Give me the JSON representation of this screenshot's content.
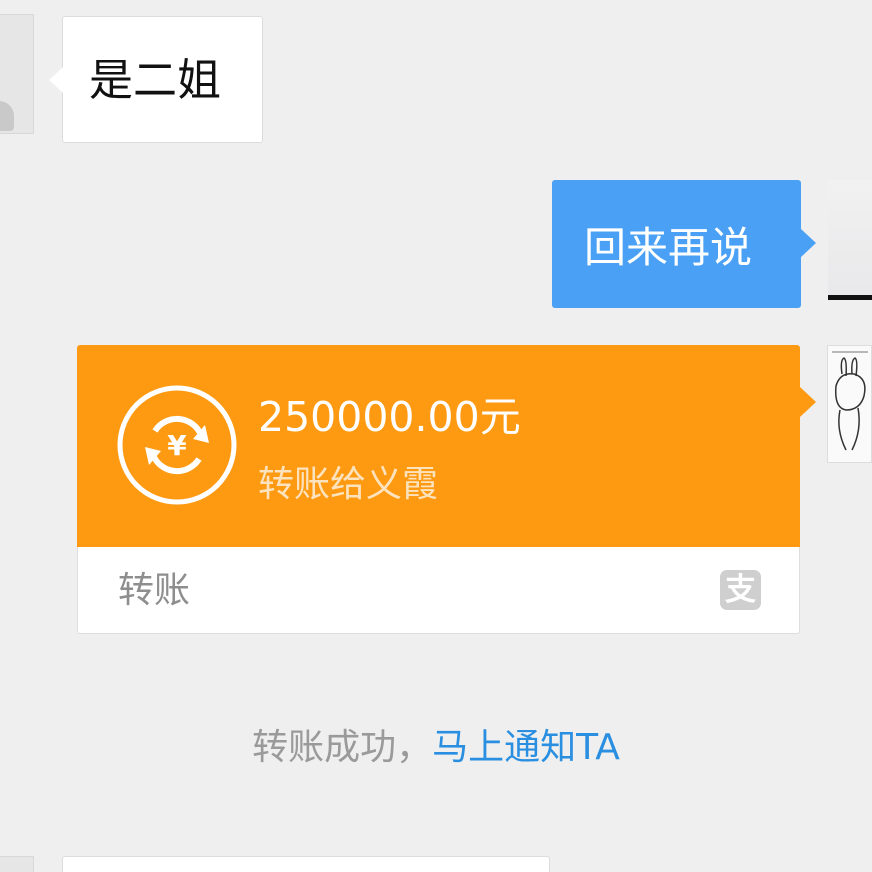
{
  "messages": {
    "incoming_text": "是二姐",
    "outgoing_text": "回来再说"
  },
  "transfer": {
    "amount": "250000.00元",
    "recipient": "转账给义霞",
    "label": "转账",
    "icon_currency": "¥",
    "alipay_glyph": "支",
    "accent_color": "#fd9a12"
  },
  "notice": {
    "prefix": "转账成功，",
    "link": "马上通知TA"
  },
  "colors": {
    "background": "#efefef",
    "outgoing_bubble": "#4aa0f5",
    "link": "#2a8fe0"
  }
}
